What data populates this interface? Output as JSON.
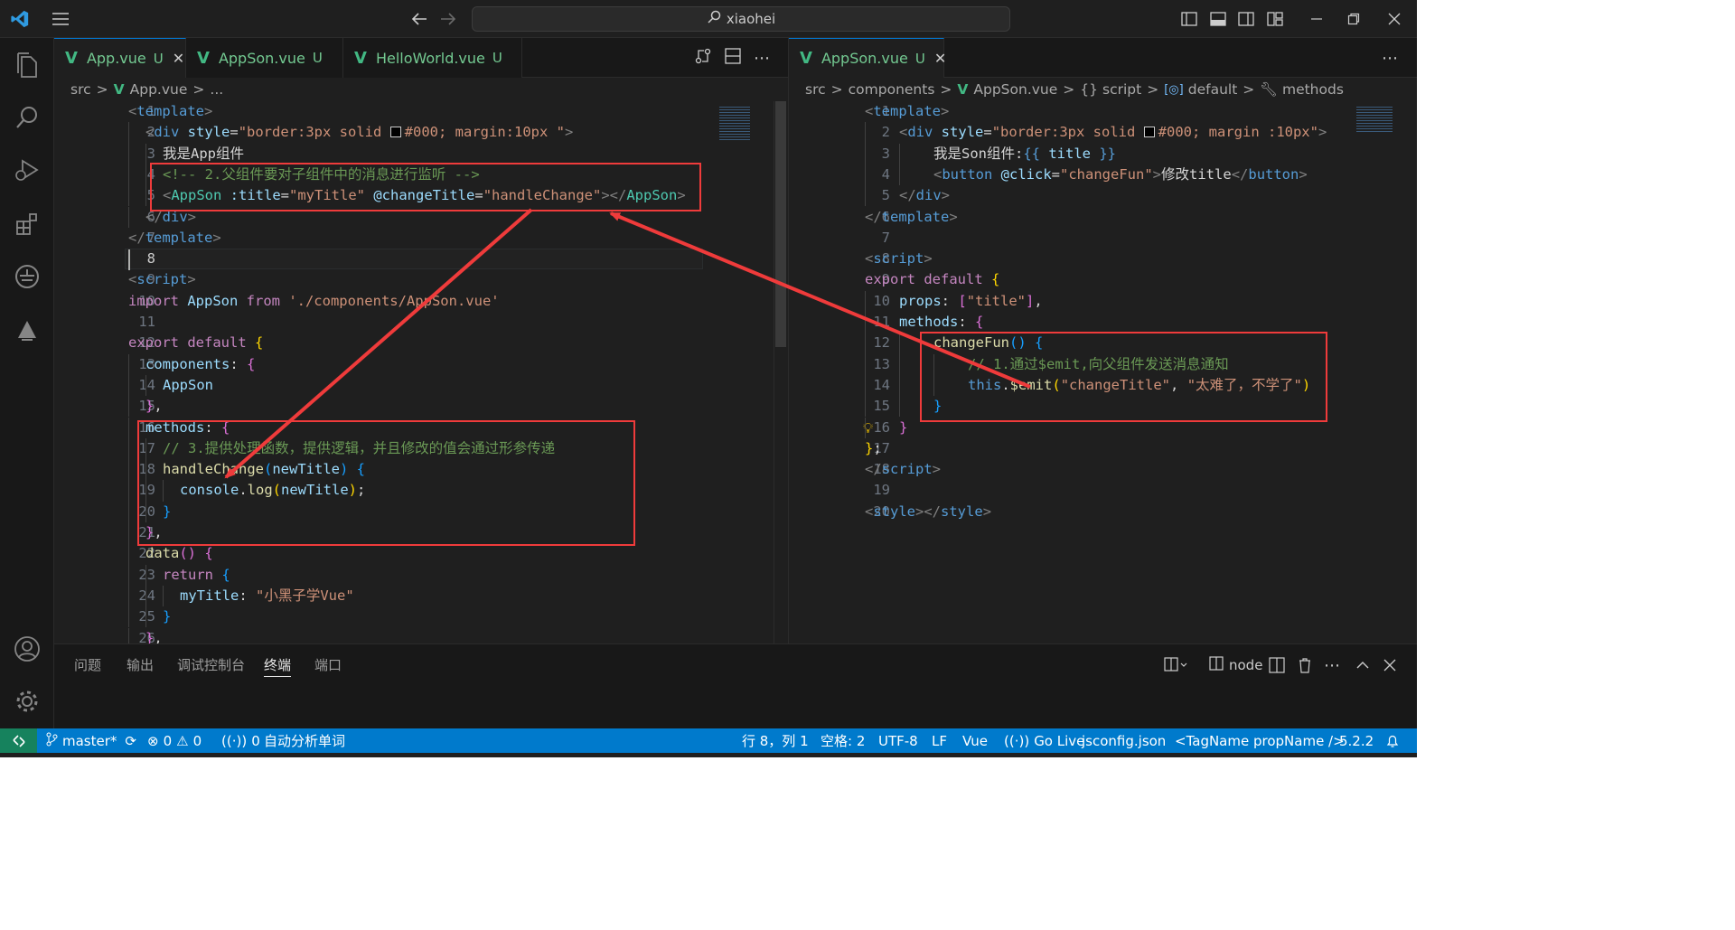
{
  "title_bar": {
    "search_text": "xiaohei"
  },
  "left_editor": {
    "tabs": [
      {
        "name": "App.vue",
        "status": "U",
        "active": true
      },
      {
        "name": "AppSon.vue",
        "status": "U",
        "active": false
      },
      {
        "name": "HelloWorld.vue",
        "status": "U",
        "active": false
      }
    ],
    "breadcrumb": {
      "src": "src",
      "sep": ">",
      "file": "App.vue",
      "more": "..."
    },
    "line_numbers": [
      "1",
      "2",
      "3",
      "4",
      "5",
      "6",
      "7",
      "8",
      "9",
      "10",
      "11",
      "12",
      "13",
      "14",
      "15",
      "16",
      "17",
      "18",
      "19",
      "20",
      "21",
      "22",
      "23",
      "24",
      "25",
      "26"
    ]
  },
  "right_editor": {
    "tabs": [
      {
        "name": "AppSon.vue",
        "status": "U",
        "active": true
      }
    ],
    "breadcrumb": {
      "src": "src",
      "components": "components",
      "file": "AppSon.vue",
      "script": "script",
      "default": "default",
      "methods": "methods"
    },
    "line_numbers": [
      "1",
      "2",
      "3",
      "4",
      "5",
      "6",
      "7",
      "8",
      "9",
      "10",
      "11",
      "12",
      "13",
      "14",
      "15",
      "16",
      "17",
      "18",
      "19",
      "20"
    ]
  },
  "panel": {
    "tabs": [
      "问题",
      "输出",
      "调试控制台",
      "终端",
      "端口"
    ],
    "active_tab": "终端",
    "terminal_name": "node"
  },
  "status_bar": {
    "branch": "master*",
    "errors": "0",
    "warnings": "0",
    "ports": "0",
    "spell": "自动分析单词",
    "position": "行 8，列 1",
    "indent": "空格: 2",
    "encoding": "UTF-8",
    "eol": "LF",
    "language": "Vue",
    "golive": "Go Live",
    "config": "jsconfig.json",
    "tagname": "<TagName propName />",
    "version": "5.2.2"
  },
  "colors": {
    "status_bar": "#007acc",
    "annotation": "#ef3b3b",
    "vue_logo": "#42b883"
  }
}
